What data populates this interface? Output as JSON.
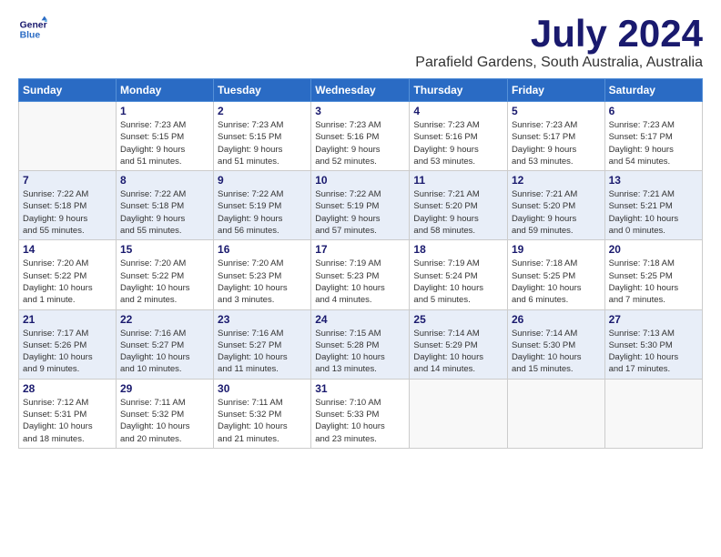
{
  "logo": {
    "line1": "General",
    "line2": "Blue"
  },
  "title": "July 2024",
  "location": "Parafield Gardens, South Australia, Australia",
  "days_of_week": [
    "Sunday",
    "Monday",
    "Tuesday",
    "Wednesday",
    "Thursday",
    "Friday",
    "Saturday"
  ],
  "weeks": [
    [
      {
        "date": "",
        "detail": ""
      },
      {
        "date": "1",
        "detail": "Sunrise: 7:23 AM\nSunset: 5:15 PM\nDaylight: 9 hours\nand 51 minutes."
      },
      {
        "date": "2",
        "detail": "Sunrise: 7:23 AM\nSunset: 5:15 PM\nDaylight: 9 hours\nand 51 minutes."
      },
      {
        "date": "3",
        "detail": "Sunrise: 7:23 AM\nSunset: 5:16 PM\nDaylight: 9 hours\nand 52 minutes."
      },
      {
        "date": "4",
        "detail": "Sunrise: 7:23 AM\nSunset: 5:16 PM\nDaylight: 9 hours\nand 53 minutes."
      },
      {
        "date": "5",
        "detail": "Sunrise: 7:23 AM\nSunset: 5:17 PM\nDaylight: 9 hours\nand 53 minutes."
      },
      {
        "date": "6",
        "detail": "Sunrise: 7:23 AM\nSunset: 5:17 PM\nDaylight: 9 hours\nand 54 minutes."
      }
    ],
    [
      {
        "date": "7",
        "detail": "Sunrise: 7:22 AM\nSunset: 5:18 PM\nDaylight: 9 hours\nand 55 minutes."
      },
      {
        "date": "8",
        "detail": "Sunrise: 7:22 AM\nSunset: 5:18 PM\nDaylight: 9 hours\nand 55 minutes."
      },
      {
        "date": "9",
        "detail": "Sunrise: 7:22 AM\nSunset: 5:19 PM\nDaylight: 9 hours\nand 56 minutes."
      },
      {
        "date": "10",
        "detail": "Sunrise: 7:22 AM\nSunset: 5:19 PM\nDaylight: 9 hours\nand 57 minutes."
      },
      {
        "date": "11",
        "detail": "Sunrise: 7:21 AM\nSunset: 5:20 PM\nDaylight: 9 hours\nand 58 minutes."
      },
      {
        "date": "12",
        "detail": "Sunrise: 7:21 AM\nSunset: 5:20 PM\nDaylight: 9 hours\nand 59 minutes."
      },
      {
        "date": "13",
        "detail": "Sunrise: 7:21 AM\nSunset: 5:21 PM\nDaylight: 10 hours\nand 0 minutes."
      }
    ],
    [
      {
        "date": "14",
        "detail": "Sunrise: 7:20 AM\nSunset: 5:22 PM\nDaylight: 10 hours\nand 1 minute."
      },
      {
        "date": "15",
        "detail": "Sunrise: 7:20 AM\nSunset: 5:22 PM\nDaylight: 10 hours\nand 2 minutes."
      },
      {
        "date": "16",
        "detail": "Sunrise: 7:20 AM\nSunset: 5:23 PM\nDaylight: 10 hours\nand 3 minutes."
      },
      {
        "date": "17",
        "detail": "Sunrise: 7:19 AM\nSunset: 5:23 PM\nDaylight: 10 hours\nand 4 minutes."
      },
      {
        "date": "18",
        "detail": "Sunrise: 7:19 AM\nSunset: 5:24 PM\nDaylight: 10 hours\nand 5 minutes."
      },
      {
        "date": "19",
        "detail": "Sunrise: 7:18 AM\nSunset: 5:25 PM\nDaylight: 10 hours\nand 6 minutes."
      },
      {
        "date": "20",
        "detail": "Sunrise: 7:18 AM\nSunset: 5:25 PM\nDaylight: 10 hours\nand 7 minutes."
      }
    ],
    [
      {
        "date": "21",
        "detail": "Sunrise: 7:17 AM\nSunset: 5:26 PM\nDaylight: 10 hours\nand 9 minutes."
      },
      {
        "date": "22",
        "detail": "Sunrise: 7:16 AM\nSunset: 5:27 PM\nDaylight: 10 hours\nand 10 minutes."
      },
      {
        "date": "23",
        "detail": "Sunrise: 7:16 AM\nSunset: 5:27 PM\nDaylight: 10 hours\nand 11 minutes."
      },
      {
        "date": "24",
        "detail": "Sunrise: 7:15 AM\nSunset: 5:28 PM\nDaylight: 10 hours\nand 13 minutes."
      },
      {
        "date": "25",
        "detail": "Sunrise: 7:14 AM\nSunset: 5:29 PM\nDaylight: 10 hours\nand 14 minutes."
      },
      {
        "date": "26",
        "detail": "Sunrise: 7:14 AM\nSunset: 5:30 PM\nDaylight: 10 hours\nand 15 minutes."
      },
      {
        "date": "27",
        "detail": "Sunrise: 7:13 AM\nSunset: 5:30 PM\nDaylight: 10 hours\nand 17 minutes."
      }
    ],
    [
      {
        "date": "28",
        "detail": "Sunrise: 7:12 AM\nSunset: 5:31 PM\nDaylight: 10 hours\nand 18 minutes."
      },
      {
        "date": "29",
        "detail": "Sunrise: 7:11 AM\nSunset: 5:32 PM\nDaylight: 10 hours\nand 20 minutes."
      },
      {
        "date": "30",
        "detail": "Sunrise: 7:11 AM\nSunset: 5:32 PM\nDaylight: 10 hours\nand 21 minutes."
      },
      {
        "date": "31",
        "detail": "Sunrise: 7:10 AM\nSunset: 5:33 PM\nDaylight: 10 hours\nand 23 minutes."
      },
      {
        "date": "",
        "detail": ""
      },
      {
        "date": "",
        "detail": ""
      },
      {
        "date": "",
        "detail": ""
      }
    ]
  ]
}
